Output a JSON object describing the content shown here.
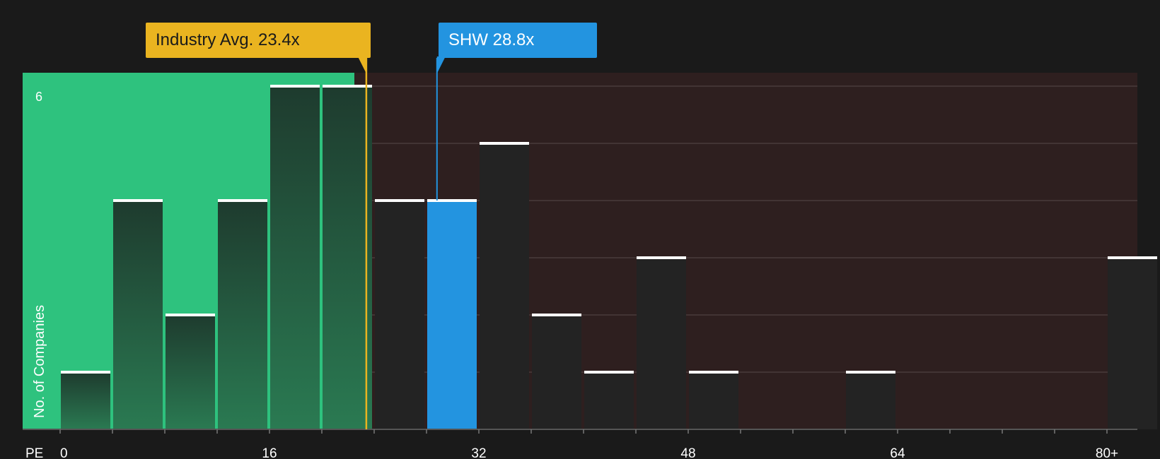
{
  "chart_data": {
    "type": "bar",
    "x_axis_label": "PE",
    "y_axis_label": "No. of Companies",
    "y_max_tick_label": "6",
    "ylim": [
      0,
      6
    ],
    "x_ticks": [
      "0",
      "16",
      "32",
      "48",
      "64",
      "80+"
    ],
    "bin_width": 4,
    "bins": [
      {
        "x_start": 0,
        "count": 1
      },
      {
        "x_start": 4,
        "count": 4
      },
      {
        "x_start": 8,
        "count": 2
      },
      {
        "x_start": 12,
        "count": 4
      },
      {
        "x_start": 16,
        "count": 6
      },
      {
        "x_start": 20,
        "count": 6
      },
      {
        "x_start": 24,
        "count": 4
      },
      {
        "x_start": 28,
        "count": 4,
        "highlight": true
      },
      {
        "x_start": 32,
        "count": 5
      },
      {
        "x_start": 36,
        "count": 2
      },
      {
        "x_start": 40,
        "count": 1
      },
      {
        "x_start": 44,
        "count": 3
      },
      {
        "x_start": 48,
        "count": 1
      },
      {
        "x_start": 60,
        "count": 1
      },
      {
        "x_start": 80,
        "count": 3
      }
    ],
    "industry_avg": {
      "label": "Industry Avg. 23.4x",
      "value": 23.4
    },
    "company": {
      "label": "SHW 28.8x",
      "value": 28.8
    },
    "colors": {
      "background": "#1a1a1a",
      "undervalued_zone": "#2ec27e",
      "overvalued_zone": "#2e1f1f",
      "bar": "#232323",
      "highlight_bar": "#2394e0",
      "industry_label": "#eab420",
      "company_label": "#2394e0",
      "text": "#ffffff"
    }
  }
}
